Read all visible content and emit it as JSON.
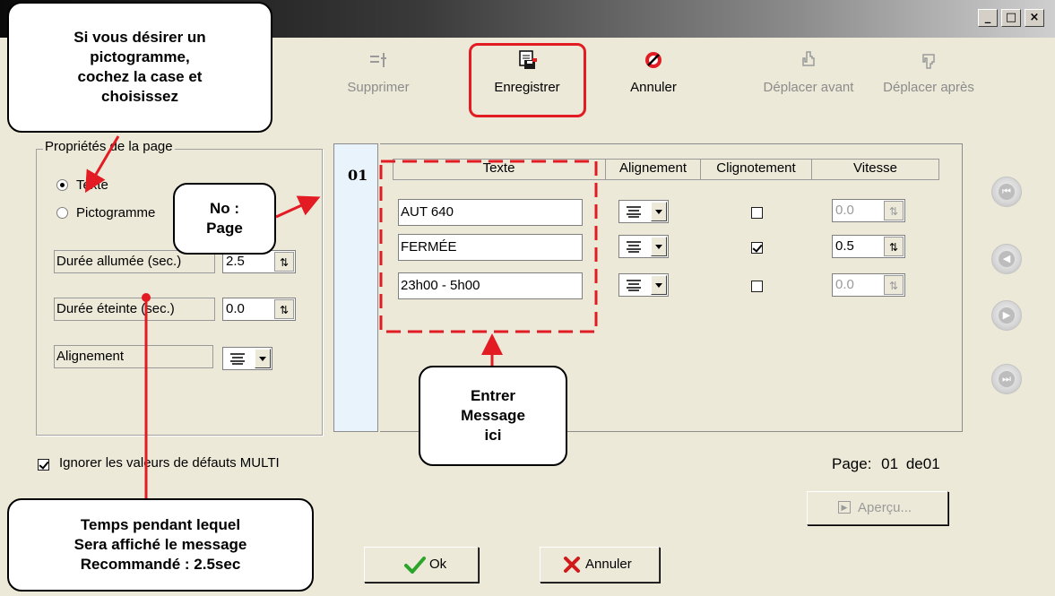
{
  "window": {
    "minimize": "_",
    "maximize": "□",
    "close": "×"
  },
  "toolbar": {
    "delete_label": "Supprimer",
    "save_label": "Enregistrer",
    "cancel_label": "Annuler",
    "move_before_label": "Déplacer avant",
    "move_after_label": "Déplacer après"
  },
  "page_props": {
    "title": "Propriétés de la page",
    "radio_text": "Texte",
    "radio_pictogram": "Pictogramme",
    "on_duration_label": "Durée allumée (sec.)",
    "on_duration_value": "2.5",
    "off_duration_label": "Durée éteinte (sec.)",
    "off_duration_value": "0.0",
    "alignment_label": "Alignement"
  },
  "page_number": "01",
  "table": {
    "headers": [
      "Texte",
      "Alignement",
      "Clignotement",
      "Vitesse"
    ],
    "rows": [
      {
        "text": "AUT 640",
        "blink": false,
        "speed": "0.0",
        "speed_enabled": false
      },
      {
        "text": "FERMÉE",
        "blink": true,
        "speed": "0.5",
        "speed_enabled": true
      },
      {
        "text": "23h00 - 5h00",
        "blink": false,
        "speed": "0.0",
        "speed_enabled": false
      }
    ]
  },
  "ignore_defaults_label": "Ignorer les valeurs de défauts MULTI",
  "ignore_defaults_checked": true,
  "pagination": {
    "label": "Page:",
    "current": "01",
    "separator": "de",
    "total": "01"
  },
  "preview_label": "Aperçu...",
  "ok_label": "Ok",
  "cancel_label": "Annuler",
  "callouts": {
    "pictogram_line1": "Si vous désirer un",
    "pictogram_line2": "pictogramme,",
    "pictogram_line3": "cochez la case et",
    "pictogram_line4": "choisissez",
    "page_no_line1": "No :",
    "page_no_line2": "Page",
    "enter_message_line1": "Entrer",
    "enter_message_line2": "Message",
    "enter_message_line3": "ici",
    "duration_line1": "Temps pendant lequel",
    "duration_line2": "Sera affiché le message",
    "duration_line3": "Recommandé : 2.5sec"
  },
  "colors": {
    "annotation_red": "#e31b23",
    "dialog_bg": "#ece9d8",
    "ok_check": "#2aa52a",
    "cancel_x": "#d11a1a"
  }
}
